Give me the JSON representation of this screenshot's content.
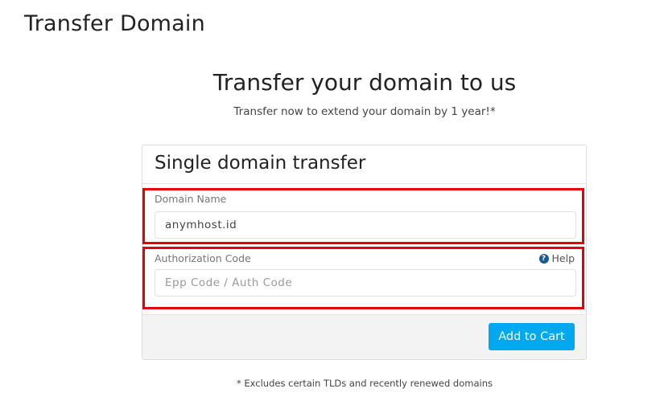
{
  "page": {
    "title": "Transfer Domain"
  },
  "hero": {
    "title": "Transfer your domain to us",
    "subtitle": "Transfer now to extend your domain by 1 year!*"
  },
  "card": {
    "title": "Single domain transfer",
    "domain_field": {
      "label": "Domain Name",
      "value": "anymhost.id"
    },
    "auth_field": {
      "label": "Authorization Code",
      "placeholder": "Epp Code / Auth Code",
      "value": ""
    },
    "help": {
      "icon": "question-circle-icon",
      "label": "Help"
    },
    "add_button": {
      "label": "Add to Cart"
    }
  },
  "footnote": "* Excludes certain TLDs and recently renewed domains",
  "colors": {
    "accent_button": "#00a8ef",
    "highlight_box": "#e3000f",
    "help_icon": "#1d5a8e"
  }
}
